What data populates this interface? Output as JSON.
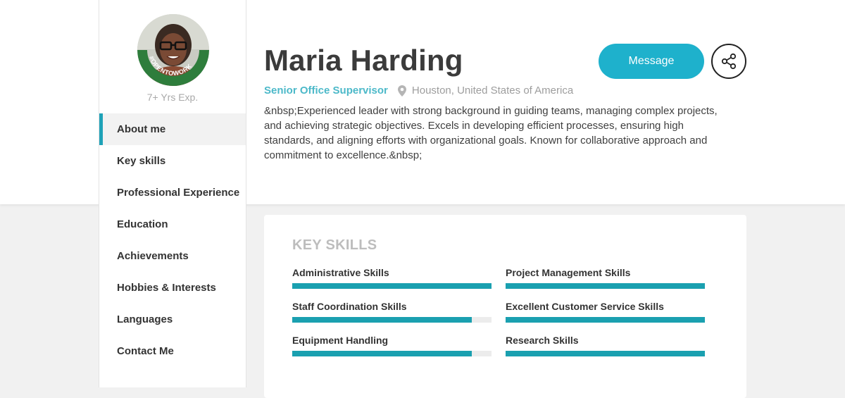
{
  "profile": {
    "experience": "7+ Yrs Exp.",
    "badge": "#OPENTOWORK",
    "name": "Maria Harding",
    "job_title": "Senior Office Supervisor",
    "location": "Houston, United States of America",
    "summary": "&nbsp;Experienced leader with strong background in guiding teams, managing complex projects, and achieving strategic objectives. Excels in developing efficient processes, ensuring high standards, and aligning efforts with organizational goals. Known for collaborative approach and commitment to excellence.&nbsp;"
  },
  "actions": {
    "message_label": "Message",
    "share_icon": "share-icon"
  },
  "sidebar": {
    "items": [
      {
        "label": "About me",
        "active": true
      },
      {
        "label": "Key skills"
      },
      {
        "label": "Professional Experience"
      },
      {
        "label": "Education"
      },
      {
        "label": "Achievements"
      },
      {
        "label": "Hobbies & Interests"
      },
      {
        "label": "Languages"
      },
      {
        "label": "Contact Me"
      }
    ]
  },
  "key_skills": {
    "heading": "KEY SKILLS",
    "skills": [
      {
        "label": "Administrative Skills",
        "level": 1.0
      },
      {
        "label": "Project Management Skills",
        "level": 1.0
      },
      {
        "label": "Staff Coordination Skills",
        "level": 0.9
      },
      {
        "label": "Excellent Customer Service Skills",
        "level": 1.0
      },
      {
        "label": "Equipment Handling",
        "level": 0.9
      },
      {
        "label": "Research Skills",
        "level": 1.0
      }
    ]
  },
  "colors": {
    "accent": "#1eb1cc",
    "skill_bar": "#1aa0b0",
    "job_title": "#4cb9c9",
    "badge_green": "#2e7d3c"
  }
}
